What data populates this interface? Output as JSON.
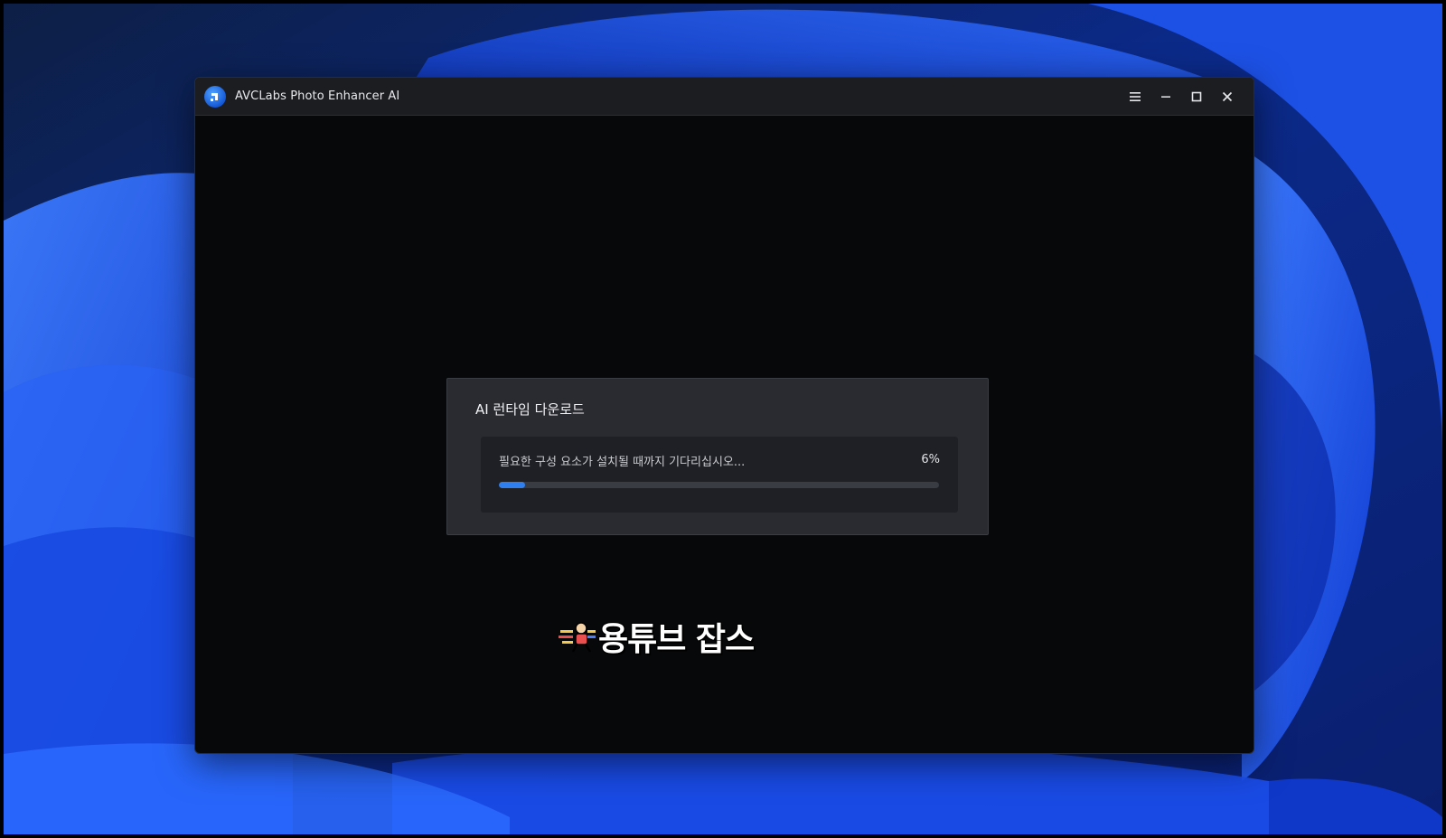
{
  "window": {
    "title": "AVCLabs Photo Enhancer AI",
    "logo_icon": "avclabs-logo-icon",
    "controls": {
      "menu_icon": "hamburger-menu-icon",
      "minimize_icon": "minimize-icon",
      "maximize_icon": "maximize-icon",
      "close_icon": "close-icon"
    }
  },
  "dialog": {
    "title": "AI 런타임 다운로드",
    "message": "필요한 구성 요소가 설치될 때까지 기다리십시오...",
    "progress_text": "6%",
    "progress_value": 0.06
  },
  "watermark": {
    "text": "용튜브 잡스"
  },
  "colors": {
    "accent": "#2f7ff0",
    "window_bg": "#07080a",
    "titlebar_bg": "#1c1d21",
    "dialog_bg": "#2a2b31",
    "panel_bg": "#1f2025",
    "wallpaper_blue": "#1a4fe0"
  }
}
